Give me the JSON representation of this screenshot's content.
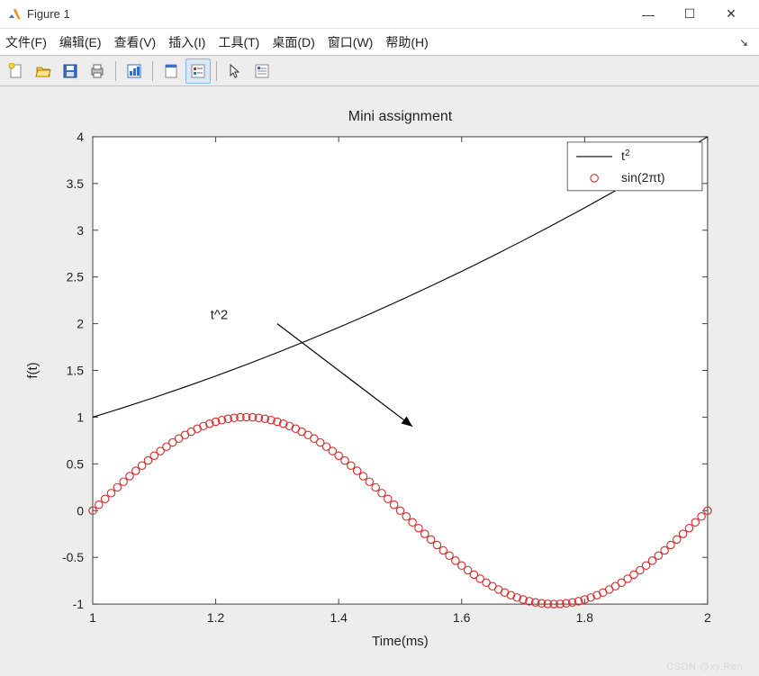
{
  "window": {
    "title": "Figure 1",
    "minimize": "—",
    "maximize": "☐",
    "close": "✕"
  },
  "menubar": {
    "items": [
      "文件(F)",
      "编辑(E)",
      "查看(V)",
      "插入(I)",
      "工具(T)",
      "桌面(D)",
      "窗口(W)",
      "帮助(H)"
    ],
    "overflow": "↘"
  },
  "toolbar": {
    "icons": [
      "new-figure",
      "open",
      "save",
      "print",
      "edit-plot",
      "link-axes",
      "insert-legend",
      "cursor",
      "properties"
    ]
  },
  "chart_data": {
    "type": "line",
    "title": "Mini assignment",
    "xlabel": "Time(ms)",
    "ylabel": "f(t)",
    "xlim": [
      1,
      2
    ],
    "ylim": [
      -1,
      4
    ],
    "xticks": [
      1,
      1.2,
      1.4,
      1.6,
      1.8,
      2
    ],
    "yticks": [
      -1,
      -0.5,
      0,
      0.5,
      1,
      1.5,
      2,
      2.5,
      3,
      3.5,
      4
    ],
    "series": [
      {
        "name": "t^2",
        "legend_label": "t²",
        "style": "line",
        "color": "#000000",
        "x": [
          1.0,
          1.05,
          1.1,
          1.15,
          1.2,
          1.25,
          1.3,
          1.35,
          1.4,
          1.45,
          1.5,
          1.55,
          1.6,
          1.65,
          1.7,
          1.75,
          1.8,
          1.85,
          1.9,
          1.95,
          2.0
        ],
        "y": [
          1.0,
          1.1025,
          1.21,
          1.3225,
          1.44,
          1.5625,
          1.69,
          1.8225,
          1.96,
          2.1025,
          2.25,
          2.4025,
          2.56,
          2.7225,
          2.89,
          3.0625,
          3.24,
          3.4225,
          3.61,
          3.8025,
          4.0
        ]
      },
      {
        "name": "sin(2*pi*t)",
        "legend_label": "sin(2πt)",
        "style": "marker",
        "marker": "o",
        "color": "#d62728",
        "x": [
          1.0,
          1.01,
          1.02,
          1.03,
          1.04,
          1.05,
          1.06,
          1.07,
          1.08,
          1.09,
          1.1,
          1.11,
          1.12,
          1.13,
          1.14,
          1.15,
          1.16,
          1.17,
          1.18,
          1.19,
          1.2,
          1.21,
          1.22,
          1.23,
          1.24,
          1.25,
          1.26,
          1.27,
          1.28,
          1.29,
          1.3,
          1.31,
          1.32,
          1.33,
          1.34,
          1.35,
          1.36,
          1.37,
          1.38,
          1.39,
          1.4,
          1.41,
          1.42,
          1.43,
          1.44,
          1.45,
          1.46,
          1.47,
          1.48,
          1.49,
          1.5,
          1.51,
          1.52,
          1.53,
          1.54,
          1.55,
          1.56,
          1.57,
          1.58,
          1.59,
          1.6,
          1.61,
          1.62,
          1.63,
          1.64,
          1.65,
          1.66,
          1.67,
          1.68,
          1.69,
          1.7,
          1.71,
          1.72,
          1.73,
          1.74,
          1.75,
          1.76,
          1.77,
          1.78,
          1.79,
          1.8,
          1.81,
          1.82,
          1.83,
          1.84,
          1.85,
          1.86,
          1.87,
          1.88,
          1.89,
          1.9,
          1.91,
          1.92,
          1.93,
          1.94,
          1.95,
          1.96,
          1.97,
          1.98,
          1.99,
          2.0
        ],
        "y": [
          0.0,
          0.0628,
          0.1253,
          0.1874,
          0.2487,
          0.309,
          0.3681,
          0.4258,
          0.4818,
          0.5358,
          0.5878,
          0.6374,
          0.6845,
          0.729,
          0.7705,
          0.809,
          0.8443,
          0.8763,
          0.9048,
          0.9298,
          0.9511,
          0.9686,
          0.9823,
          0.9921,
          0.998,
          1.0,
          0.998,
          0.9921,
          0.9823,
          0.9686,
          0.9511,
          0.9298,
          0.9048,
          0.8763,
          0.8443,
          0.809,
          0.7705,
          0.729,
          0.6845,
          0.6374,
          0.5878,
          0.5358,
          0.4818,
          0.4258,
          0.3681,
          0.309,
          0.2487,
          0.1874,
          0.1253,
          0.0628,
          0.0,
          -0.0628,
          -0.1253,
          -0.1874,
          -0.2487,
          -0.309,
          -0.3681,
          -0.4258,
          -0.4818,
          -0.5358,
          -0.5878,
          -0.6374,
          -0.6845,
          -0.729,
          -0.7705,
          -0.809,
          -0.8443,
          -0.8763,
          -0.9048,
          -0.9298,
          -0.9511,
          -0.9686,
          -0.9823,
          -0.9921,
          -0.998,
          -1.0,
          -0.998,
          -0.9921,
          -0.9823,
          -0.9686,
          -0.9511,
          -0.9298,
          -0.9048,
          -0.8763,
          -0.8443,
          -0.809,
          -0.7705,
          -0.729,
          -0.6845,
          -0.6374,
          -0.5878,
          -0.5358,
          -0.4818,
          -0.4258,
          -0.3681,
          -0.309,
          -0.2487,
          -0.1874,
          -0.1253,
          -0.0628,
          0.0
        ]
      }
    ],
    "legend": {
      "entries": [
        "t²",
        "sin(2πt)"
      ],
      "position": "upper-right"
    },
    "annotation": {
      "text": "t^2",
      "text_xy": [
        1.22,
        2.05
      ],
      "arrow_from": [
        1.3,
        2.0
      ],
      "arrow_to": [
        1.52,
        0.9
      ]
    }
  },
  "watermark": "CSDN @xy.Ren"
}
